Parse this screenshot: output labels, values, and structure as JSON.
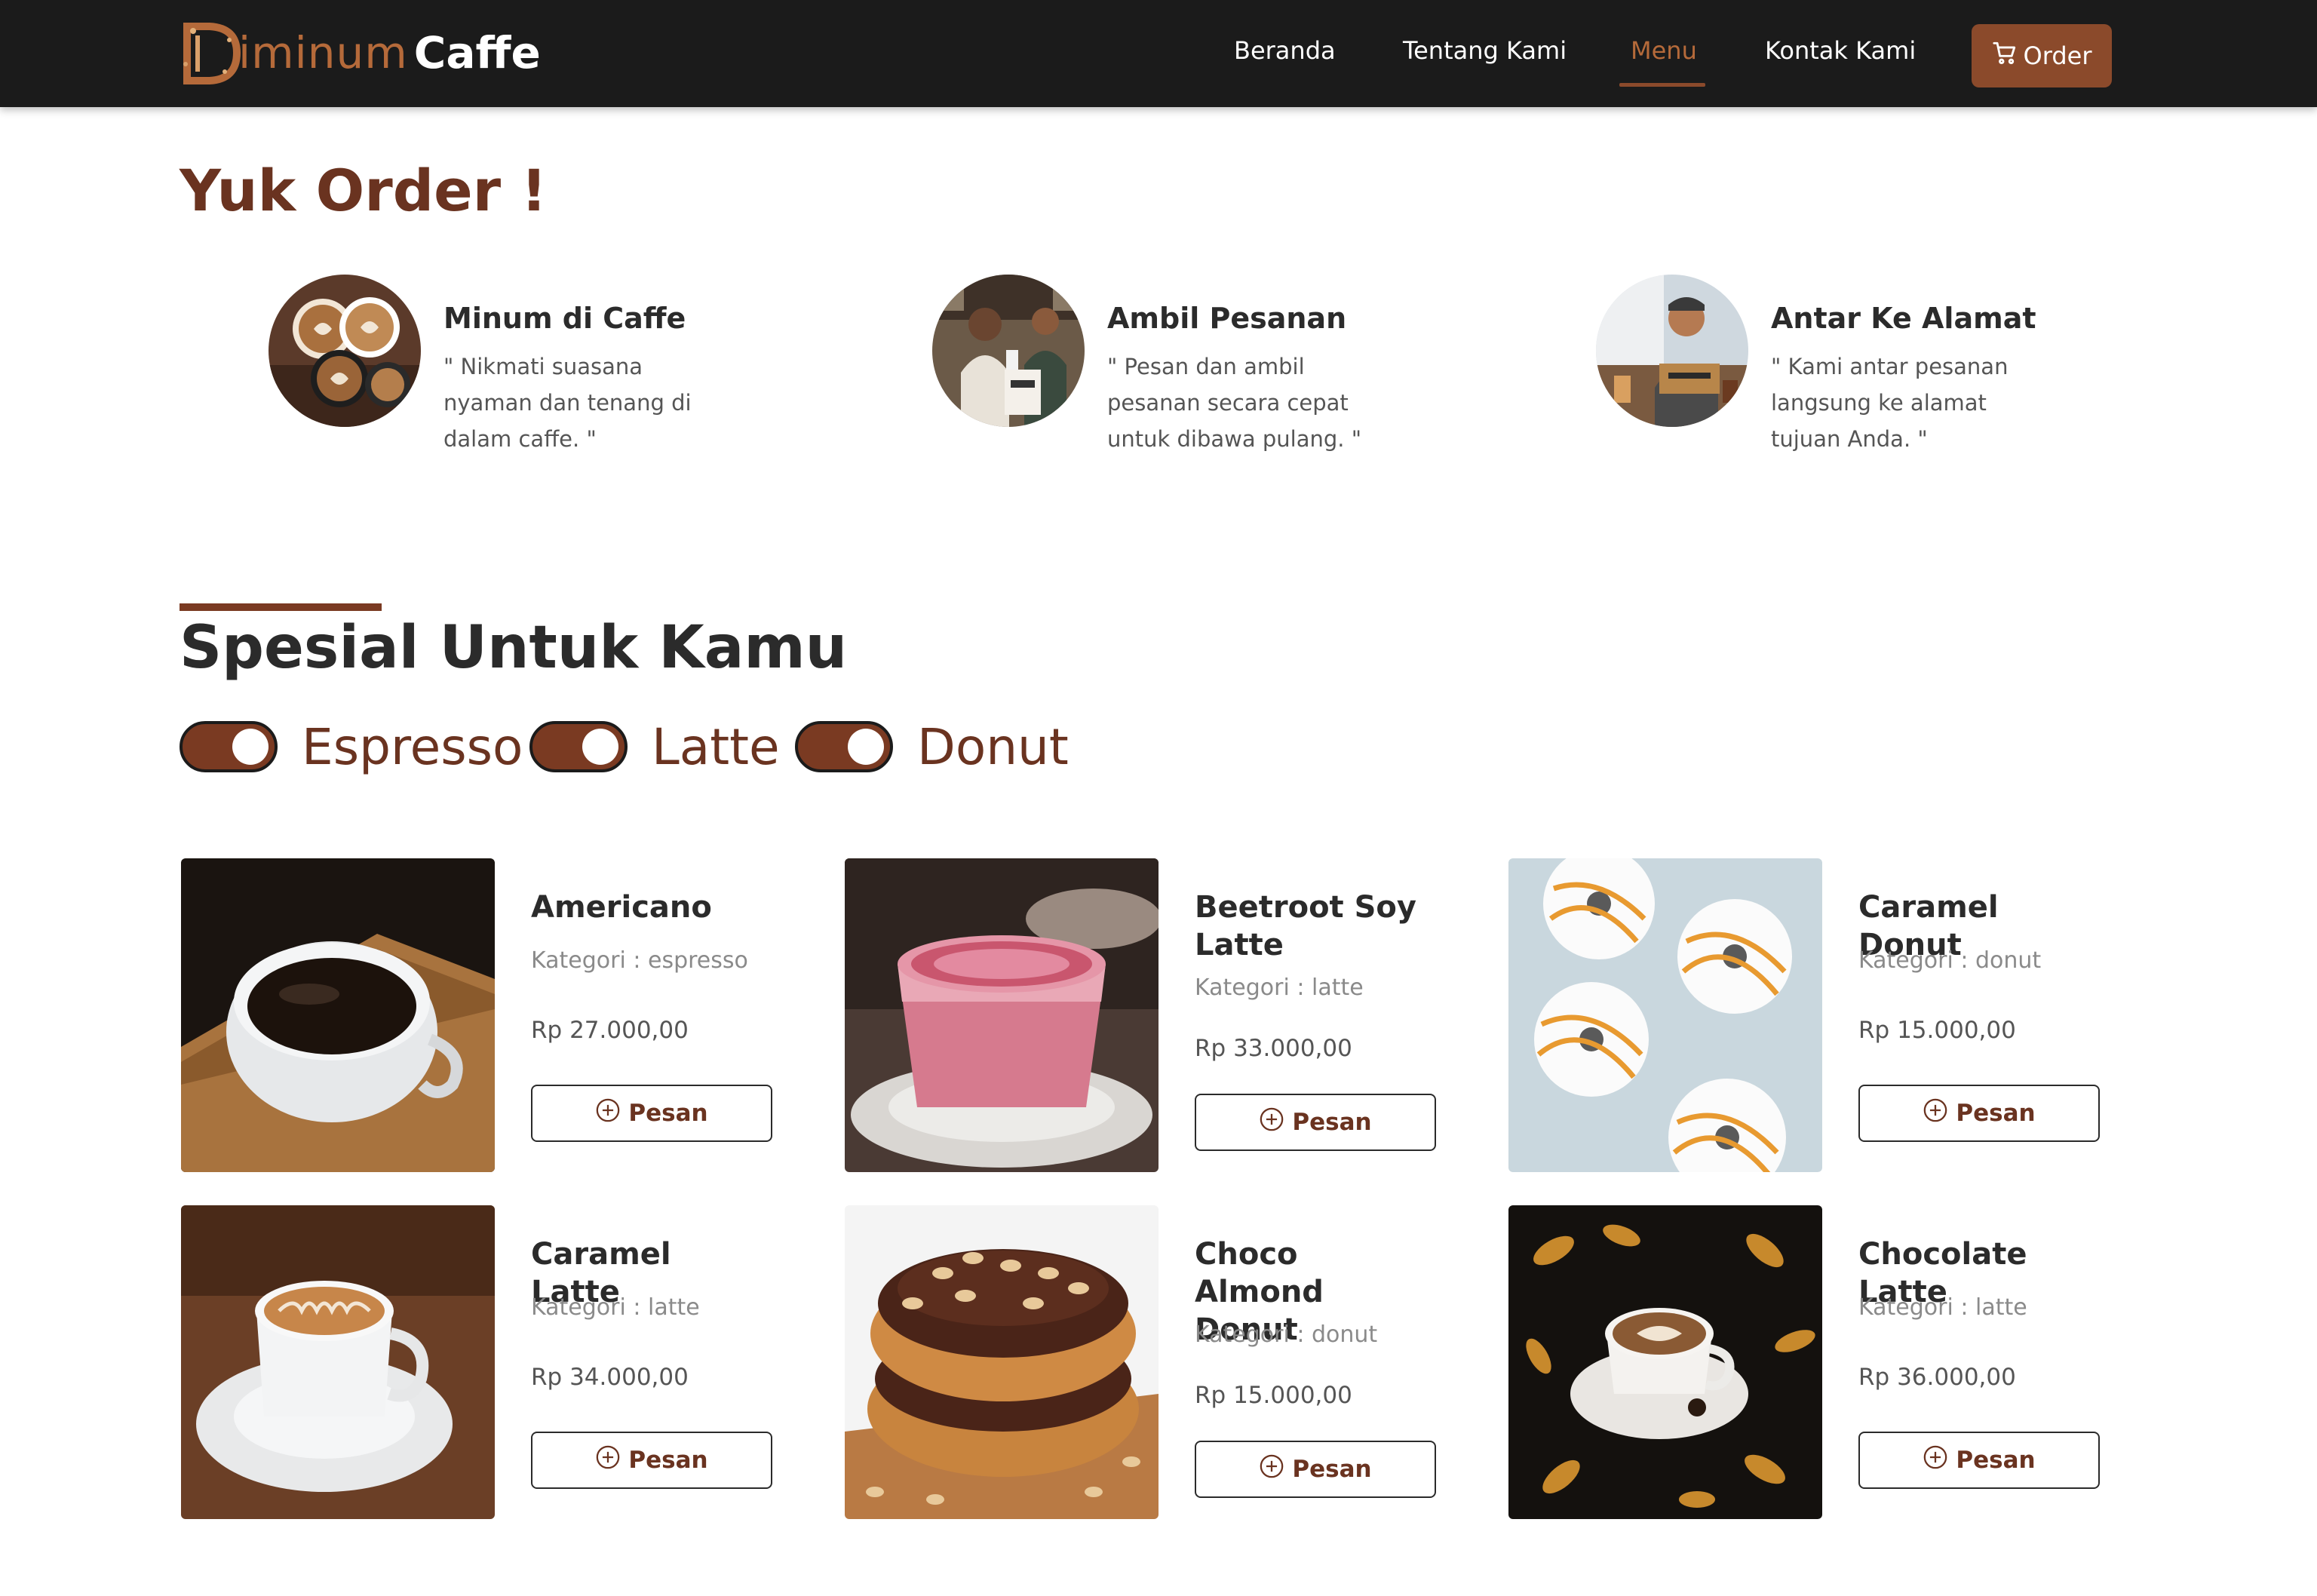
{
  "nav": {
    "brand_part1": "iminum",
    "brand_part2": "Caffe",
    "links": [
      {
        "label": "Beranda"
      },
      {
        "label": "Tentang Kami"
      },
      {
        "label": "Menu"
      },
      {
        "label": "Kontak Kami"
      }
    ],
    "active_link": "Menu",
    "order_label": "Order",
    "order_icon": "cart-icon"
  },
  "order_section": {
    "title": "Yuk Order !",
    "services": [
      {
        "title": "Minum di Caffe",
        "description": "\" Nikmati suasana nyaman dan tenang di dalam caffe. \""
      },
      {
        "title": "Ambil Pesanan",
        "description": "\" Pesan dan ambil pesanan secara cepat untuk dibawa pulang. \""
      },
      {
        "title": "Antar Ke Alamat",
        "description": "\" Kami antar pesanan langsung ke alamat tujuan Anda. \""
      }
    ]
  },
  "special_section": {
    "title": "Spesial Untuk Kamu",
    "filters": [
      {
        "label": "Espresso",
        "checked": true
      },
      {
        "label": "Latte",
        "checked": true
      },
      {
        "label": "Donut",
        "checked": true
      }
    ],
    "products": [
      {
        "name": "Americano",
        "category": "Kategori : espresso",
        "price": "Rp 27.000,00",
        "button": "Pesan"
      },
      {
        "name": "Beetroot Soy Latte",
        "category": "Kategori : latte",
        "price": "Rp 33.000,00",
        "button": "Pesan"
      },
      {
        "name": "Caramel Donut",
        "category": "Kategori : donut",
        "price": "Rp 15.000,00",
        "button": "Pesan"
      },
      {
        "name": "Caramel Latte",
        "category": "Kategori : latte",
        "price": "Rp 34.000,00",
        "button": "Pesan"
      },
      {
        "name": "Choco Almond Donut",
        "category": "Kategori : donut",
        "price": "Rp 15.000,00",
        "button": "Pesan"
      },
      {
        "name": "Chocolate Latte",
        "category": "Kategori : latte",
        "price": "Rp 36.000,00",
        "button": "Pesan"
      }
    ]
  },
  "colors": {
    "navbar_bg": "#1b1b1b",
    "accent_brown": "#8b4a2b",
    "title_brown": "#6a3320"
  }
}
